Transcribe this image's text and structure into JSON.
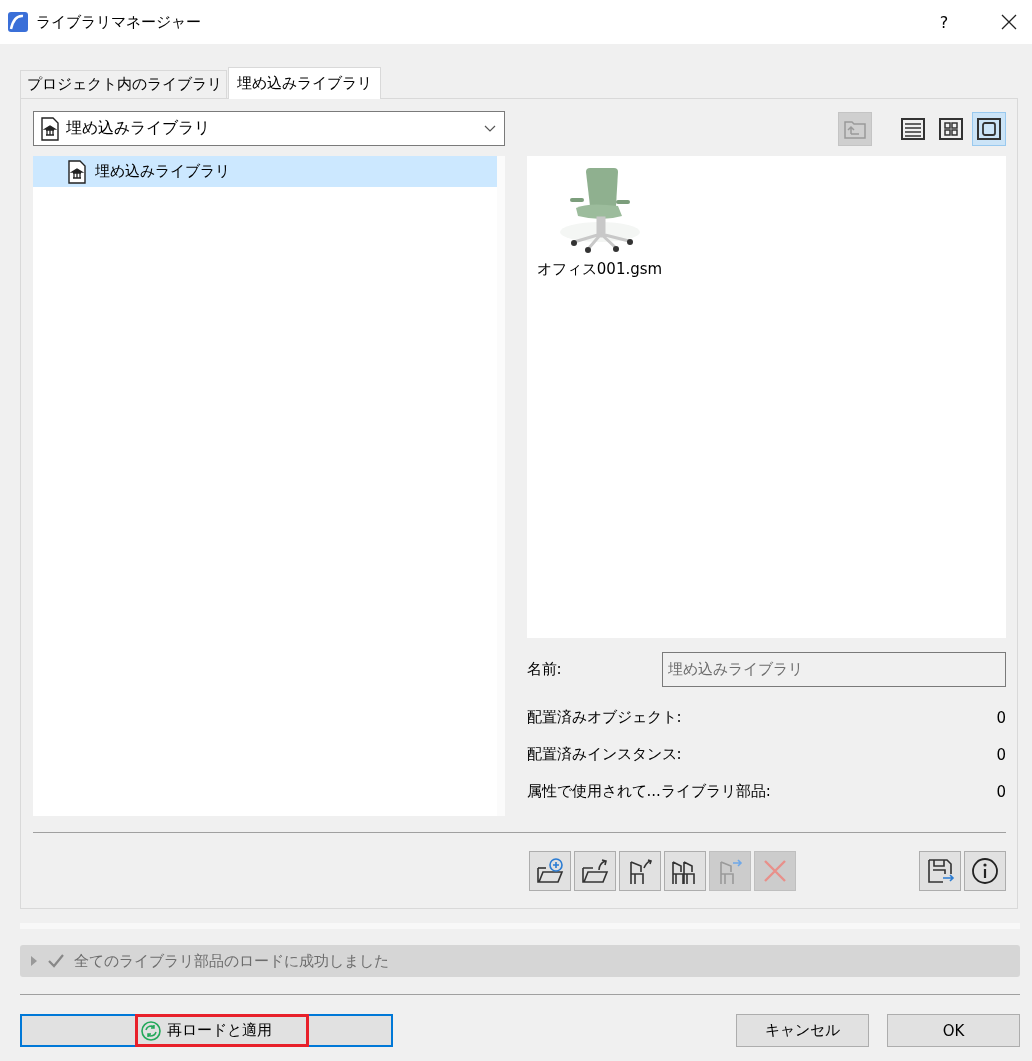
{
  "window": {
    "title": "ライブラリマネージャー",
    "help": "?"
  },
  "tabs": [
    {
      "label": "プロジェクト内のライブラリ",
      "selected": false
    },
    {
      "label": "埋め込みライブラリ",
      "selected": true
    }
  ],
  "library_dropdown": {
    "value": "埋め込みライブラリ"
  },
  "tree": {
    "items": [
      {
        "label": "埋め込みライブラリ",
        "selected": true
      }
    ]
  },
  "view_buttons": [
    {
      "kind": "up",
      "selected": false,
      "disabled": true
    },
    {
      "kind": "list",
      "selected": false,
      "disabled": false
    },
    {
      "kind": "grid",
      "selected": false,
      "disabled": false
    },
    {
      "kind": "large",
      "selected": true,
      "disabled": false
    }
  ],
  "files": [
    {
      "name": "オフィス001.gsm",
      "kind": "picture"
    }
  ],
  "details": {
    "name_label": "名前:",
    "name_value": "埋め込みライブラリ",
    "stats": [
      {
        "label": "配置済みオブジェクト:",
        "value": "0"
      },
      {
        "label": "配置済みインスタンス:",
        "value": "0"
      },
      {
        "label": "属性で使用されて...ライブラリ部品:",
        "value": "0"
      }
    ]
  },
  "actions": [
    {
      "kind": "add-folder",
      "disabled": false
    },
    {
      "kind": "export-folder",
      "disabled": false
    },
    {
      "kind": "export-object",
      "disabled": false
    },
    {
      "kind": "objects",
      "disabled": false
    },
    {
      "kind": "move-object",
      "disabled": true
    },
    {
      "kind": "delete",
      "disabled": true
    }
  ],
  "actions_right": [
    {
      "kind": "save",
      "disabled": false
    },
    {
      "kind": "info",
      "disabled": false
    }
  ],
  "status_bar": {
    "message": "全てのライブラリ部品のロードに成功しました",
    "expanded": false
  },
  "buttons": [
    {
      "kind": "reload",
      "label": "再ロードと適用",
      "focused": true,
      "highlighted": true
    },
    {
      "kind": "plain",
      "label": "キャンセル",
      "focused": false,
      "highlighted": false
    },
    {
      "kind": "plain",
      "label": "OK",
      "focused": false,
      "highlighted": false
    }
  ]
}
